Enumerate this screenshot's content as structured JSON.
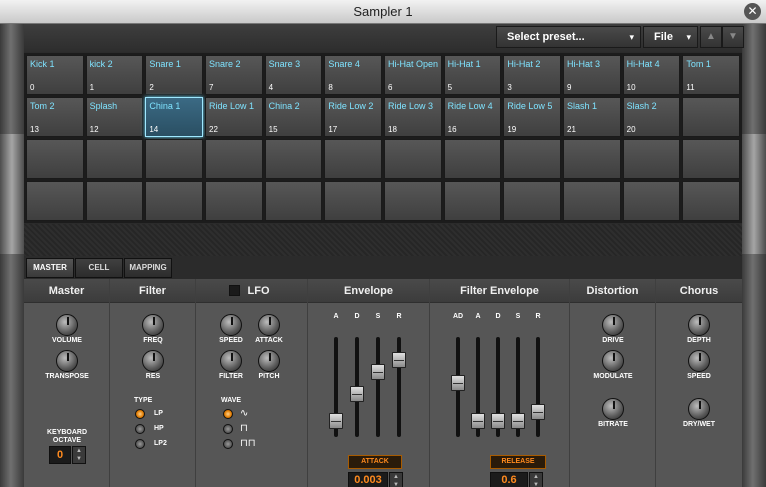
{
  "window": {
    "title": "Sampler 1",
    "close_label": "✕"
  },
  "toolbar": {
    "preset_label": "Select preset...",
    "file_label": "File",
    "caret": "▾",
    "up_arrow": "▲",
    "down_arrow": "▼"
  },
  "cells": [
    {
      "name": "Kick 1",
      "id": "0"
    },
    {
      "name": "kick 2",
      "id": "1"
    },
    {
      "name": "Snare 1",
      "id": "2"
    },
    {
      "name": "Snare 2",
      "id": "7"
    },
    {
      "name": "Snare 3",
      "id": "4"
    },
    {
      "name": "Snare 4",
      "id": "8"
    },
    {
      "name": "Hi-Hat Open",
      "id": "6"
    },
    {
      "name": "Hi-Hat 1",
      "id": "5"
    },
    {
      "name": "Hi-Hat 2",
      "id": "3"
    },
    {
      "name": "Hi-Hat 3",
      "id": "9"
    },
    {
      "name": "Hi-Hat 4",
      "id": "10"
    },
    {
      "name": "Tom 1",
      "id": "11"
    },
    {
      "name": "Tom 2",
      "id": "13"
    },
    {
      "name": "Splash",
      "id": "12"
    },
    {
      "name": "China 1",
      "id": "14"
    },
    {
      "name": "Ride Low 1",
      "id": "22"
    },
    {
      "name": "China 2",
      "id": "15"
    },
    {
      "name": "Ride Low 2",
      "id": "17"
    },
    {
      "name": "Ride Low 3",
      "id": "18"
    },
    {
      "name": "Ride Low 4",
      "id": "16"
    },
    {
      "name": "Ride Low 5",
      "id": "19"
    },
    {
      "name": "Slash 1",
      "id": "21"
    },
    {
      "name": "Slash 2",
      "id": "20"
    },
    {
      "name": "",
      "id": ""
    },
    {
      "name": "",
      "id": ""
    },
    {
      "name": "",
      "id": ""
    },
    {
      "name": "",
      "id": ""
    },
    {
      "name": "",
      "id": ""
    },
    {
      "name": "",
      "id": ""
    },
    {
      "name": "",
      "id": ""
    },
    {
      "name": "",
      "id": ""
    },
    {
      "name": "",
      "id": ""
    },
    {
      "name": "",
      "id": ""
    },
    {
      "name": "",
      "id": ""
    },
    {
      "name": "",
      "id": ""
    },
    {
      "name": "",
      "id": ""
    },
    {
      "name": "",
      "id": ""
    },
    {
      "name": "",
      "id": ""
    },
    {
      "name": "",
      "id": ""
    },
    {
      "name": "",
      "id": ""
    },
    {
      "name": "",
      "id": ""
    },
    {
      "name": "",
      "id": ""
    },
    {
      "name": "",
      "id": ""
    },
    {
      "name": "",
      "id": ""
    },
    {
      "name": "",
      "id": ""
    },
    {
      "name": "",
      "id": ""
    },
    {
      "name": "",
      "id": ""
    },
    {
      "name": "",
      "id": ""
    }
  ],
  "selected_cell": "China 1",
  "tabs": {
    "master": "MASTER",
    "cell": "CELL",
    "mapping": "MAPPING"
  },
  "sections": {
    "master": "Master",
    "filter": "Filter",
    "lfo": "LFO",
    "envelope": "Envelope",
    "filter_envelope": "Filter Envelope",
    "distortion": "Distortion",
    "chorus": "Chorus"
  },
  "master": {
    "volume": "VOLUME",
    "transpose": "TRANSPOSE",
    "keyboard": "KEYBOARD",
    "octave": "OCTAVE",
    "octave_value": "0"
  },
  "filter": {
    "freq": "FREQ",
    "res": "RES",
    "type_label": "TYPE",
    "types": [
      "LP",
      "HP",
      "LP2"
    ],
    "selected_type": "LP"
  },
  "lfo": {
    "speed": "SPEED",
    "attack": "ATTACK",
    "filter": "FILTER",
    "pitch": "PITCH",
    "wave_label": "WAVE",
    "waves": [
      "∿",
      "⊓",
      "⊓⊓"
    ]
  },
  "envelope": {
    "labels": [
      "A",
      "D",
      "S",
      "R"
    ],
    "levels": [
      0.1,
      0.42,
      0.68,
      0.82
    ],
    "button": "ATTACK",
    "value": "0.003"
  },
  "filter_envelope": {
    "labels": [
      "AD",
      "A",
      "D",
      "S",
      "R"
    ],
    "levels": [
      0.55,
      0.1,
      0.1,
      0.1,
      0.2
    ],
    "button": "RELEASE",
    "value": "0.6"
  },
  "distortion": {
    "drive": "DRIVE",
    "modulate": "MODULATE",
    "bitrate": "BITRATE"
  },
  "chorus": {
    "depth": "DEPTH",
    "speed": "SPEED",
    "drywet": "DRY/WET"
  },
  "colors": {
    "cell_text": "#7fe3ff",
    "accent": "#ff8a1e"
  }
}
